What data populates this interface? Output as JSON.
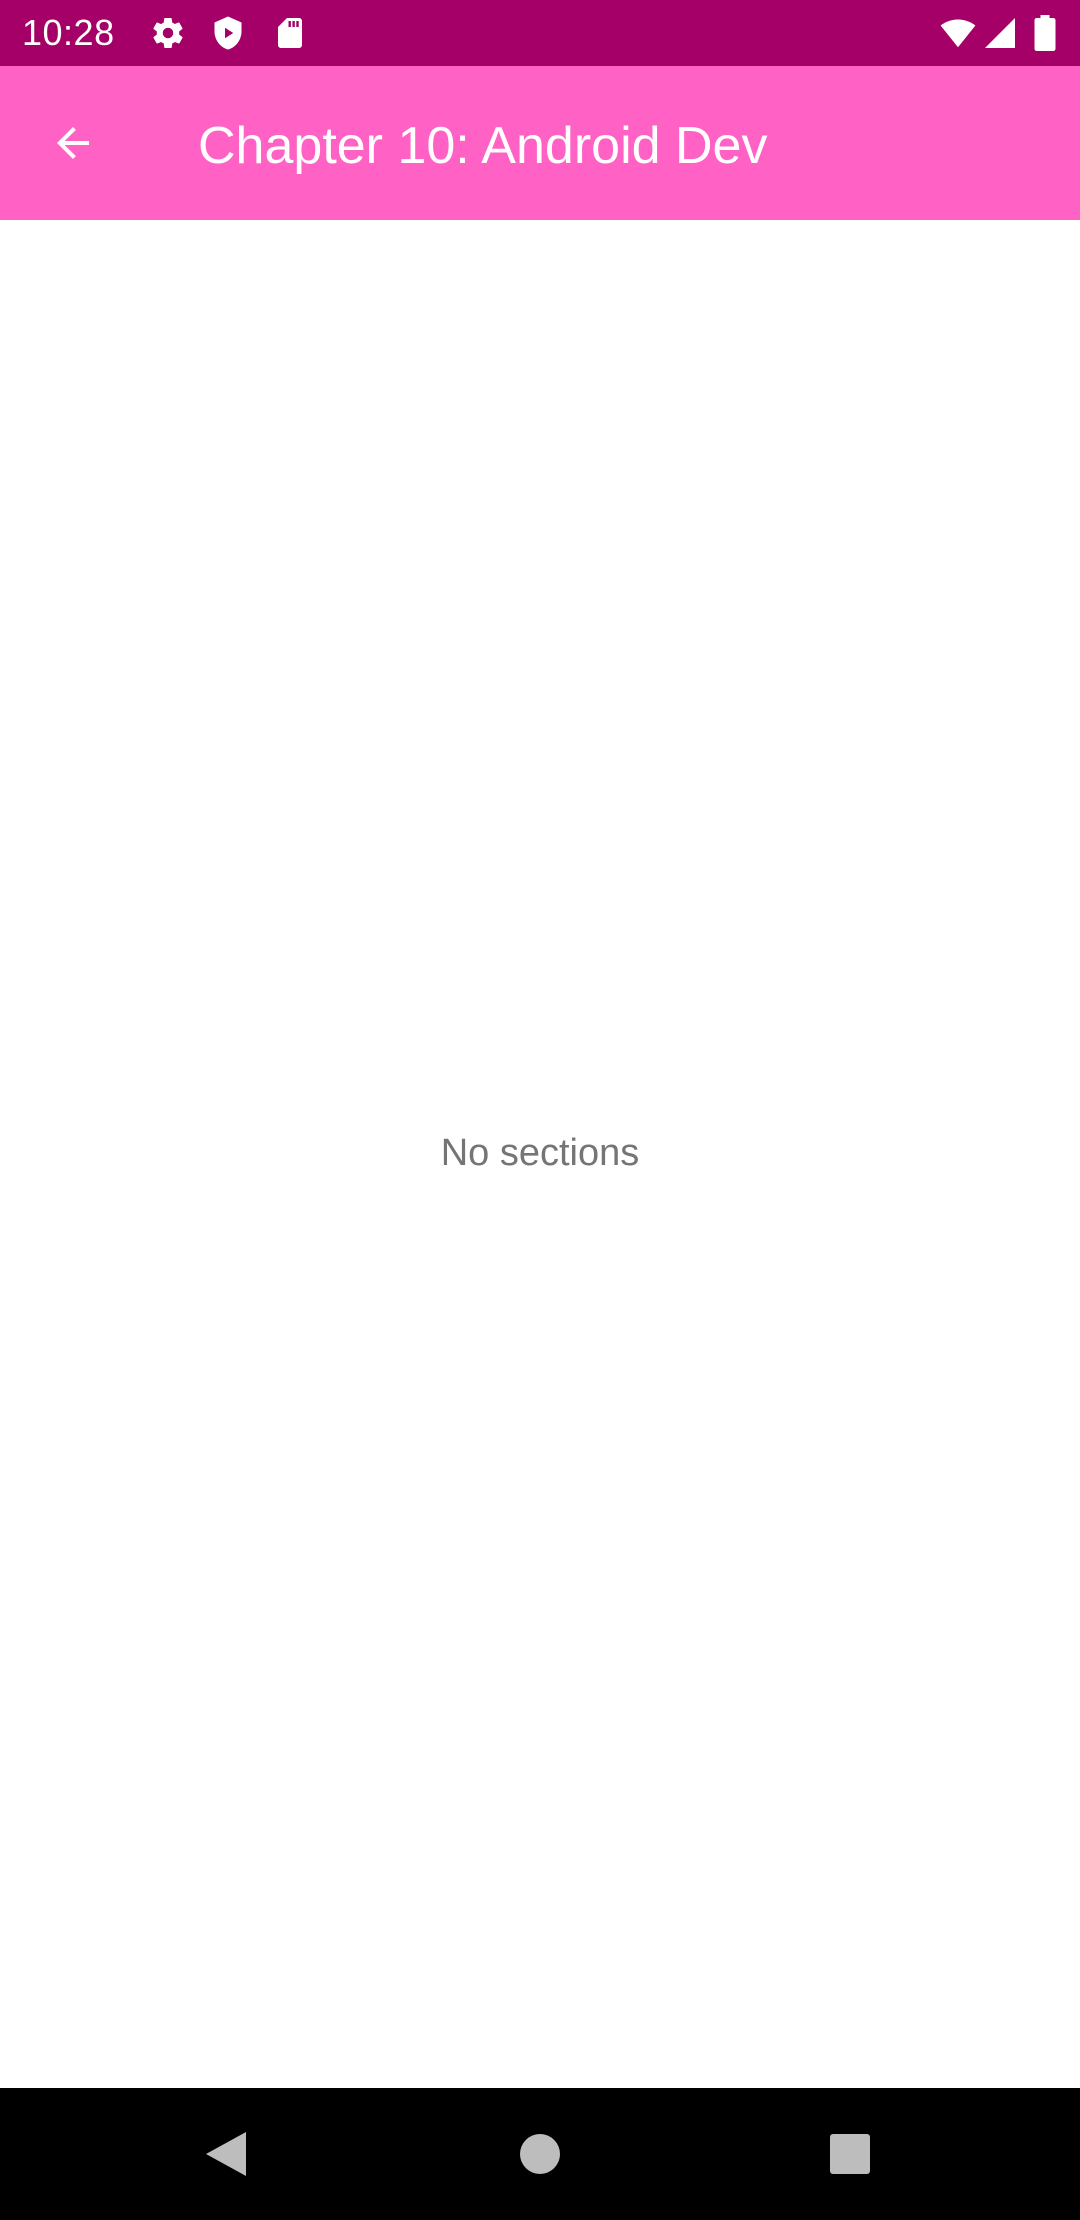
{
  "status_bar": {
    "time": "10:28",
    "left_icons": [
      "settings-icon",
      "shield-icon",
      "sd-card-icon"
    ],
    "right_icons": [
      "wifi-icon",
      "cellular-signal-icon",
      "battery-icon"
    ],
    "background_color": "#a50067"
  },
  "app_bar": {
    "back_icon": "arrow-back-icon",
    "title": "Chapter 10: Android Dev",
    "background_color": "#ff61c4"
  },
  "main": {
    "empty_message": "No sections"
  },
  "nav_bar": {
    "buttons": [
      "back-triangle-icon",
      "home-circle-icon",
      "recents-square-icon"
    ]
  }
}
